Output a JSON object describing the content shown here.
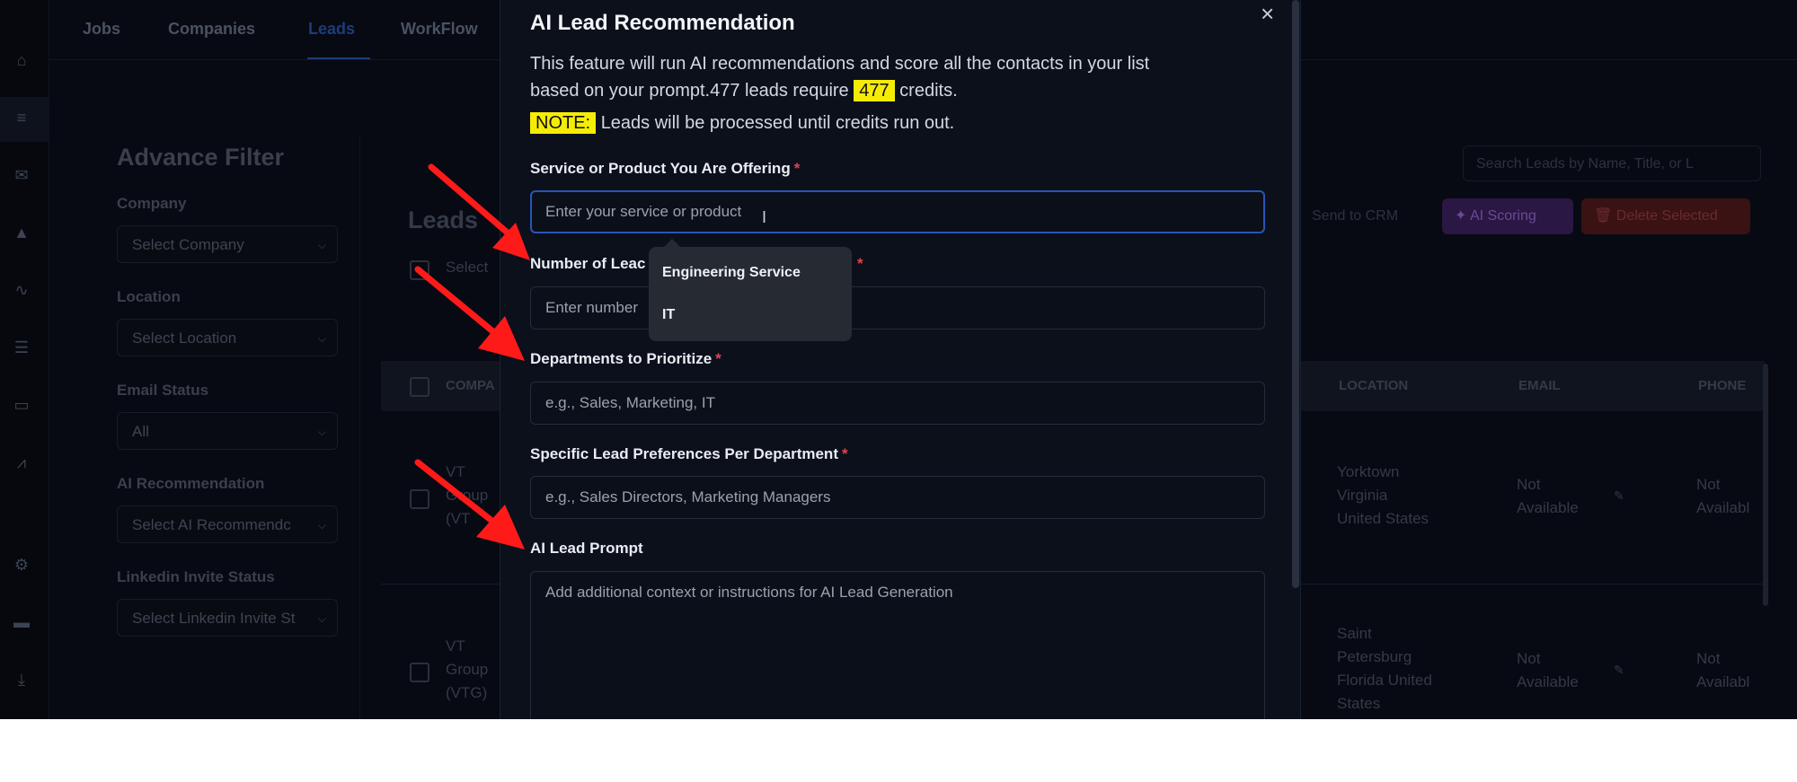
{
  "nav": {
    "tabs": [
      "Jobs",
      "Companies",
      "Leads",
      "WorkFlow"
    ],
    "active_tab": "Leads"
  },
  "rail_icons": [
    "home-icon",
    "list-icon",
    "mail-icon",
    "flask-icon",
    "workflow-icon",
    "table-icon",
    "inbox-icon",
    "chart-icon",
    "gear-icon",
    "card-icon",
    "download-icon"
  ],
  "filter": {
    "title": "Advance Filter",
    "fields": [
      {
        "label": "Company",
        "value": "Select Company"
      },
      {
        "label": "Location",
        "value": "Select Location"
      },
      {
        "label": "Email Status",
        "value": "All"
      },
      {
        "label": "AI Recommendation",
        "value": "Select AI Recommendc"
      },
      {
        "label": "Linkedin Invite Status",
        "value": "Select Linkedin Invite St"
      }
    ]
  },
  "leads": {
    "title": "Leads",
    "select_label": "Select",
    "search_placeholder": "Search Leads by Name, Title, or L",
    "send_to_crm": "Send to CRM",
    "ai_scoring": "AI Scoring",
    "delete_selected": "Delete Selected",
    "columns": [
      "COMPA",
      "LOCATION",
      "EMAIL",
      "PHONE"
    ],
    "rows": [
      {
        "company": [
          "VT",
          "Group",
          "(VT"
        ],
        "location": [
          "Yorktown",
          "Virginia",
          "United States"
        ],
        "email": [
          "Not",
          "Available"
        ],
        "phone": [
          "Not",
          "Availabl"
        ]
      },
      {
        "company": [
          "VT",
          "Group",
          "(VTG)"
        ],
        "location": [
          "Saint",
          "Petersburg",
          "Florida United",
          "States"
        ],
        "email": [
          "Not",
          "Available"
        ],
        "phone": [
          "Not",
          "Availabl"
        ]
      }
    ]
  },
  "modal": {
    "title": "AI Lead Recommendation",
    "close": "×",
    "desc_line1": "This feature will run AI recommendations and score all the contacts in your list",
    "desc_line2_prefix": "based on your prompt.477 leads require",
    "credits": "477",
    "desc_line2_suffix": "credits.",
    "note_tag": "NOTE:",
    "note_text": "Leads will be processed until credits run out.",
    "fields": {
      "service": {
        "label": "Service or Product You Are Offering",
        "placeholder": "Enter your service or product"
      },
      "number": {
        "label": "Number of Leac",
        "placeholder": "Enter number"
      },
      "departments": {
        "label": "Departments to Prioritize",
        "placeholder": "e.g., Sales, Marketing, IT"
      },
      "preferences": {
        "label": "Specific Lead Preferences Per Department",
        "placeholder": "e.g., Sales Directors, Marketing Managers"
      },
      "prompt": {
        "label": "AI Lead Prompt",
        "placeholder": "Add additional context or instructions for AI Lead Generation"
      }
    },
    "required_mark": "*"
  },
  "suggestions": [
    "Engineering Service",
    "IT"
  ],
  "colors": {
    "highlight": "#f5ec06",
    "required": "#e0444e",
    "focus": "#2856b8",
    "arrow": "#ff1a1a"
  }
}
